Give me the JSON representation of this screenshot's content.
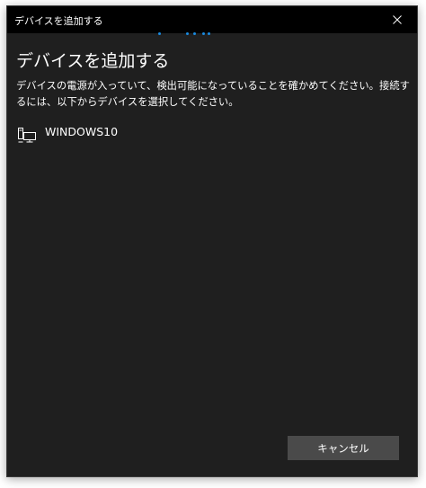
{
  "window": {
    "title": "デバイスを追加する",
    "close_label": "×"
  },
  "main": {
    "heading": "デバイスを追加する",
    "instructions": "デバイスの電源が入っていて、検出可能になっていることを確かめてください。接続するには、以下からデバイスを選択してください。"
  },
  "devices": [
    {
      "name": "WINDOWS10",
      "icon": "computer-icon"
    }
  ],
  "footer": {
    "cancel_label": "キャンセル"
  },
  "colors": {
    "accent": "#1b8be0",
    "background": "#1f1f1f",
    "titlebar": "#000000",
    "button": "#4a4a4a"
  }
}
